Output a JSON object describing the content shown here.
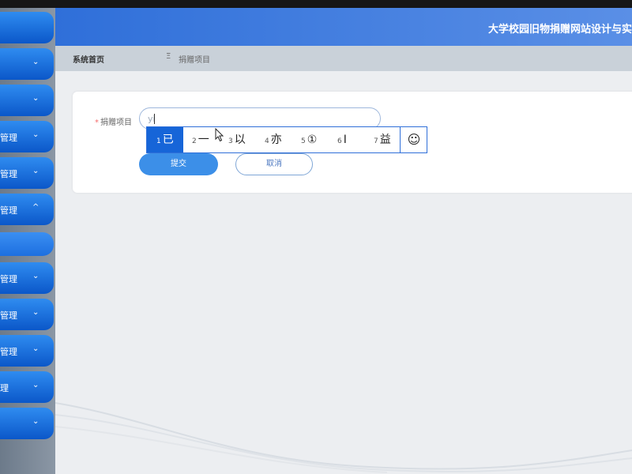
{
  "player_title": "",
  "sidebar": {
    "items": [
      {
        "label": "",
        "chevron": ""
      },
      {
        "label": "",
        "chevron": "⌄"
      },
      {
        "label": "",
        "chevron": "⌄"
      },
      {
        "label": "管理",
        "chevron": "⌄"
      },
      {
        "label": "管理",
        "chevron": "⌄"
      },
      {
        "label": "管理",
        "chevron": "^"
      },
      {
        "label": "",
        "chevron": ""
      },
      {
        "label": "管理",
        "chevron": "⌄"
      },
      {
        "label": "管理",
        "chevron": "⌄"
      },
      {
        "label": "管理",
        "chevron": "⌄"
      },
      {
        "label": "理",
        "chevron": "⌄"
      },
      {
        "label": "",
        "chevron": "⌄"
      }
    ]
  },
  "header": {
    "title": "大学校园旧物捐赠网站设计与实"
  },
  "breadcrumb": {
    "home": "系统首页",
    "separator": "Ξ",
    "current": "捐赠项目"
  },
  "form": {
    "required_mark": "*",
    "label": "捐赠项目",
    "input_value": "yi",
    "submit_label": "提交",
    "cancel_label": "取消"
  },
  "ime": {
    "candidates": [
      {
        "num": "1",
        "text": "已"
      },
      {
        "num": "2",
        "text": "一"
      },
      {
        "num": "3",
        "text": "以"
      },
      {
        "num": "4",
        "text": "亦"
      },
      {
        "num": "5",
        "text": "①"
      },
      {
        "num": "6",
        "text": "Ⅰ"
      },
      {
        "num": "7",
        "text": "益"
      }
    ],
    "emoji": "☺"
  },
  "colors": {
    "accent": "#2f6fd9",
    "sidebar_button": "#0b57c9",
    "submit": "#3c8fe8"
  }
}
